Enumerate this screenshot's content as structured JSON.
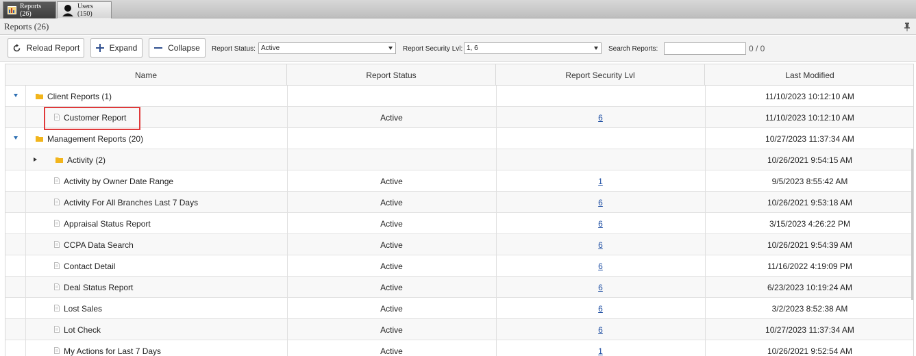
{
  "tabs": [
    {
      "label": "Reports (26)",
      "icon": "report-icon",
      "active": true
    },
    {
      "label": "Users (150)",
      "icon": "user-icon",
      "active": false
    }
  ],
  "panel": {
    "title": "Reports (26)"
  },
  "toolbar": {
    "reload_label": "Reload Report",
    "expand_label": "Expand",
    "collapse_label": "Collapse",
    "status_label": "Report Status:",
    "status_value": "Active",
    "security_label": "Report Security Lvl:",
    "security_value": "1, 6",
    "search_label": "Search Reports:",
    "search_value": "",
    "search_count": "0 / 0"
  },
  "grid": {
    "columns": [
      "Name",
      "Report Status",
      "Report Security Lvl",
      "Last Modified"
    ],
    "rows": [
      {
        "kind": "group",
        "level": 0,
        "expanded": true,
        "name": "Client Reports (1)",
        "status": "",
        "security": "",
        "modified": "11/10/2023 10:12:10 AM"
      },
      {
        "kind": "item",
        "level": 1,
        "name": "Customer Report",
        "status": "Active",
        "security": "6",
        "modified": "11/10/2023 10:12:10 AM"
      },
      {
        "kind": "group",
        "level": 0,
        "expanded": true,
        "name": "Management Reports (20)",
        "status": "",
        "security": "",
        "modified": "10/27/2023 11:37:34 AM"
      },
      {
        "kind": "group",
        "level": 1,
        "expanded": false,
        "name": "Activity (2)",
        "status": "",
        "security": "",
        "modified": "10/26/2021 9:54:15 AM"
      },
      {
        "kind": "item",
        "level": 1,
        "name": "Activity by Owner Date Range",
        "status": "Active",
        "security": "1",
        "modified": "9/5/2023 8:55:42 AM"
      },
      {
        "kind": "item",
        "level": 1,
        "name": "Activity For All Branches Last 7 Days",
        "status": "Active",
        "security": "6",
        "modified": "10/26/2021 9:53:18 AM"
      },
      {
        "kind": "item",
        "level": 1,
        "name": "Appraisal Status Report",
        "status": "Active",
        "security": "6",
        "modified": "3/15/2023 4:26:22 PM"
      },
      {
        "kind": "item",
        "level": 1,
        "name": "CCPA Data Search",
        "status": "Active",
        "security": "6",
        "modified": "10/26/2021 9:54:39 AM"
      },
      {
        "kind": "item",
        "level": 1,
        "name": "Contact Detail",
        "status": "Active",
        "security": "6",
        "modified": "11/16/2022 4:19:09 PM"
      },
      {
        "kind": "item",
        "level": 1,
        "name": "Deal Status Report",
        "status": "Active",
        "security": "6",
        "modified": "6/23/2023 10:19:24 AM"
      },
      {
        "kind": "item",
        "level": 1,
        "name": "Lost Sales",
        "status": "Active",
        "security": "6",
        "modified": "3/2/2023 8:52:38 AM"
      },
      {
        "kind": "item",
        "level": 1,
        "name": "Lot Check",
        "status": "Active",
        "security": "6",
        "modified": "10/27/2023 11:37:34 AM"
      },
      {
        "kind": "item",
        "level": 1,
        "name": "My Actions for Last 7 Days",
        "status": "Active",
        "security": "1",
        "modified": "10/26/2021 9:52:54 AM"
      }
    ]
  },
  "colors": {
    "accent": "#2d6fb3",
    "link": "#1f4fa3",
    "highlight": "#e0393a",
    "folder": "#f2b51c"
  }
}
